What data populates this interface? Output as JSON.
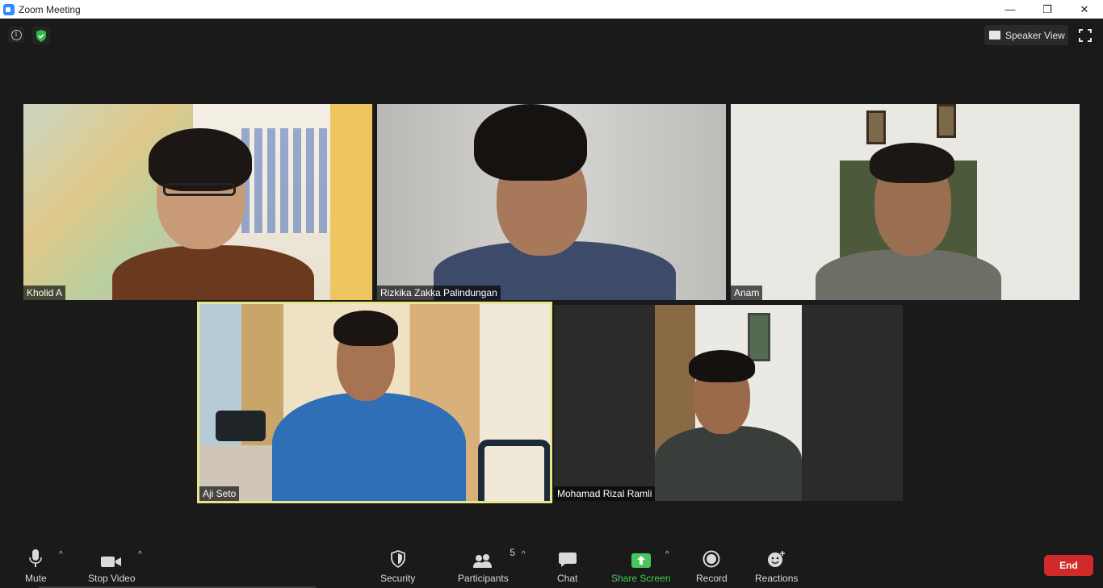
{
  "window": {
    "title": "Zoom Meeting",
    "minimize": "—",
    "restore": "❐",
    "close": "✕"
  },
  "top": {
    "speaker_view_label": "Speaker View"
  },
  "participants": [
    {
      "name": "Kholid A",
      "active": false
    },
    {
      "name": "Rizkika Zakka Palindungan",
      "active": false
    },
    {
      "name": "Anam",
      "active": false
    },
    {
      "name": "Aji Seto",
      "active": true
    },
    {
      "name": "Mohamad Rizal Ramli",
      "active": false
    }
  ],
  "toolbar": {
    "mute": "Mute",
    "stop_video": "Stop Video",
    "security": "Security",
    "participants": "Participants",
    "participant_count": "5",
    "chat": "Chat",
    "share_screen": "Share Screen",
    "record": "Record",
    "reactions": "Reactions",
    "end": "End",
    "caret": "^"
  },
  "colors": {
    "active_speaker_border": "#e7e78a",
    "share_green": "#49c75a",
    "end_red": "#d12a2a",
    "background": "#1a1a1a"
  }
}
